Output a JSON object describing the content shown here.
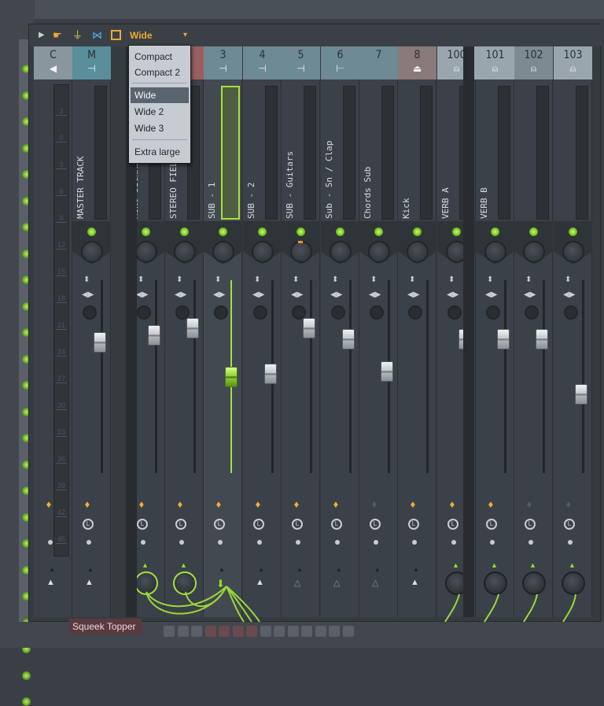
{
  "toolbar": {
    "icons": [
      "play-arrow-icon",
      "hand-icon",
      "antenna-icon",
      "bowtie-icon",
      "square-icon"
    ],
    "layout_label": "Wide",
    "dropdown_arrow": "▾"
  },
  "dropdown": {
    "items": [
      {
        "label": "Compact",
        "selected": false
      },
      {
        "label": "Compact 2",
        "selected": false
      },
      {
        "label": "Wide",
        "selected": true
      },
      {
        "label": "Wide 2",
        "selected": false
      },
      {
        "label": "Wide 3",
        "selected": false
      },
      {
        "label": "Extra large",
        "selected": false
      }
    ]
  },
  "meter_scale": [
    "3",
    "0",
    "3",
    "6",
    "9",
    "12",
    "15",
    "18",
    "21",
    "24",
    "27",
    "30",
    "33",
    "36",
    "39",
    "42",
    "45"
  ],
  "tracks": [
    {
      "num": "C",
      "icon": "speaker-icon",
      "name": "",
      "hdr": "#8a969e",
      "fader": null,
      "lamp": "on",
      "send": "tri"
    },
    {
      "num": "M",
      "icon": "routing-icon",
      "name": "MASTER TRACK",
      "hdr": "#5a8e9a",
      "fader": 0.7,
      "lamp": "on",
      "send": "tri"
    },
    {
      "num": "",
      "icon": "",
      "name": "MONO SIGNAL",
      "hdr": "#5a6e78",
      "fader": 0.74,
      "lamp": "on",
      "send": "knob-lit"
    },
    {
      "num": "",
      "icon": "",
      "name": "STEREO FIELD",
      "hdr": "#9a5e5e",
      "fader": 0.78,
      "lamp": "on",
      "send": "knob-lit"
    },
    {
      "num": "3",
      "icon": "routing-icon",
      "name": "SUB - 1",
      "hdr": "#6e8a94",
      "fader": 0.5,
      "lamp": "on",
      "send": "arrow-green",
      "selected": true
    },
    {
      "num": "4",
      "icon": "routing-icon",
      "name": "SUB - 2",
      "hdr": "#6e8a94",
      "fader": 0.52,
      "lamp": "on",
      "send": "tri"
    },
    {
      "num": "5",
      "icon": "routing-icon",
      "name": "SUB - Guitars",
      "hdr": "#6e8a94",
      "fader": 0.78,
      "lamp": "on",
      "send": "tri-dim"
    },
    {
      "num": "6",
      "icon": "routing-out-icon",
      "name": "Sub - Sn / Clap",
      "hdr": "#6e8a94",
      "fader": 0.72,
      "lamp": "on",
      "send": "tri-dim"
    },
    {
      "num": "7",
      "icon": "",
      "name": "Chords Sub",
      "hdr": "#6e8a94",
      "fader": 0.53,
      "lamp": "off",
      "send": "tri-dim"
    },
    {
      "num": "8",
      "icon": "plug-icon",
      "name": "Kick",
      "hdr": "#8a7a7a",
      "fader": null,
      "lamp": "on",
      "send": "tri"
    },
    {
      "num": "100",
      "icon": "mic-icon",
      "name": "VERB A",
      "hdr": "#9aa6ae",
      "fader": 0.72,
      "lamp": "on",
      "send": "knob"
    },
    {
      "num": "101",
      "icon": "mic-icon",
      "name": "VERB B",
      "hdr": "#9aa6ae",
      "fader": 0.72,
      "lamp": "on",
      "send": "knob"
    },
    {
      "num": "102",
      "icon": "mic-icon",
      "name": "",
      "hdr": "#7e8a92",
      "fader": 0.72,
      "lamp": "off",
      "send": "knob"
    },
    {
      "num": "103",
      "icon": "mic-icon",
      "name": "",
      "hdr": "#9aa6ae",
      "fader": 0.4,
      "lamp": "off",
      "send": "knob"
    }
  ],
  "pattern": {
    "name": "Squeek Topper"
  },
  "colors": {
    "accent": "#f0a830",
    "selected_green": "#a6e040",
    "led_green": "#72c020"
  }
}
